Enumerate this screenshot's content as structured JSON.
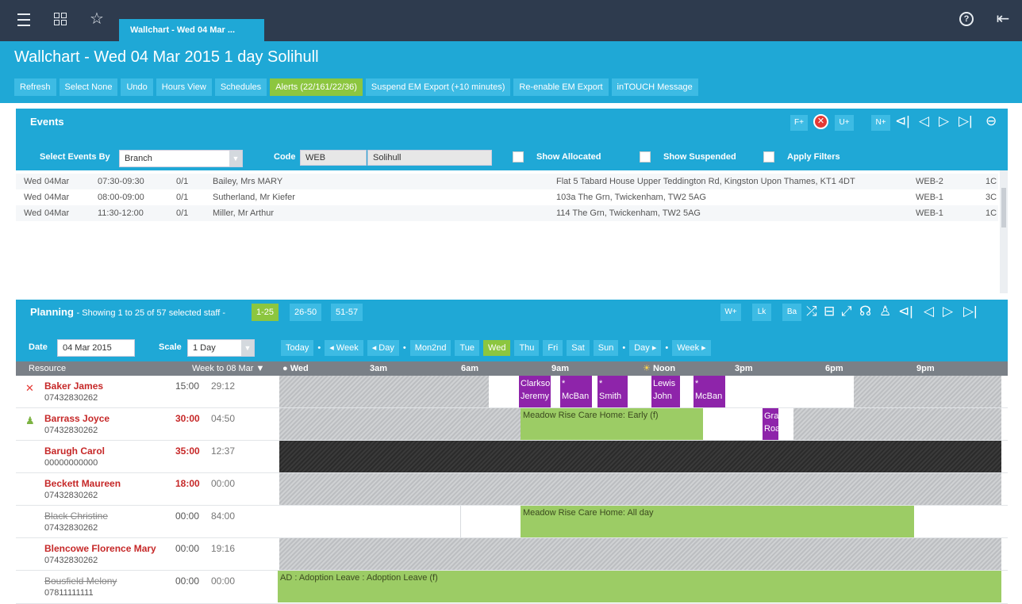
{
  "window": {
    "tab": "Wallchart - Wed 04 Mar ..."
  },
  "page": {
    "title": "Wallchart - Wed 04 Mar 2015 1 day Solihull",
    "actions": [
      "Refresh",
      "Select None",
      "Undo",
      "Hours View",
      "Schedules",
      "Alerts (22/161/22/36)",
      "Suspend EM Export (+10 minutes)",
      "Re-enable EM Export",
      "inTOUCH Message"
    ]
  },
  "events": {
    "title": "Events",
    "buttons": {
      "f": "F+",
      "u": "U+",
      "n": "N+"
    },
    "filters": {
      "select_by_label": "Select Events By",
      "select_by_value": "Branch",
      "code_label": "Code",
      "code_value": "WEB",
      "branch_value": "Solihull",
      "show_allocated": "Show Allocated",
      "show_suspended": "Show Suspended",
      "apply_filters": "Apply Filters"
    },
    "rows": [
      {
        "day": "Wed",
        "date": "04Mar",
        "time": "07:30-09:30",
        "alloc": "0/1",
        "client": "Bailey, Mrs MARY",
        "address": "Flat 5 Tabard House Upper Teddington Rd, Kingston Upon Thames, KT1 4DT",
        "code": "WEB-2",
        "extra": "1C"
      },
      {
        "day": "Wed",
        "date": "04Mar",
        "time": "08:00-09:00",
        "alloc": "0/1",
        "client": "Sutherland, Mr Kiefer",
        "address": "103a The Grn, Twickenham, TW2 5AG",
        "code": "WEB-1",
        "extra": "3C"
      },
      {
        "day": "Wed",
        "date": "04Mar",
        "time": "11:30-12:00",
        "alloc": "0/1",
        "client": "Miller, Mr Arthur",
        "address": "114 The Grn, Twickenham, TW2 5AG",
        "code": "WEB-1",
        "extra": "1C"
      }
    ]
  },
  "planning": {
    "title": "Planning",
    "subtitle": "- Showing 1 to 25 of 57 selected staff -",
    "pages": [
      "1-25",
      "26-50",
      "51-57"
    ],
    "buttons": {
      "w": "W+",
      "lk": "Lk",
      "ba": "Ba"
    },
    "date_label": "Date",
    "date_value": "04 Mar 2015",
    "scale_label": "Scale",
    "scale_value": "1 Day",
    "daynav": [
      "Today",
      "◂ Week",
      "◂ Day",
      "Mon2nd",
      "Tue",
      "Wed",
      "Thu",
      "Fri",
      "Sat",
      "Sun",
      "Day ▸",
      "Week ▸"
    ],
    "grid_header": {
      "resource": "Resource",
      "week": "Week to 08 Mar ▼",
      "times": [
        "Wed",
        "3am",
        "6am",
        "9am",
        "Noon",
        "3pm",
        "6pm",
        "9pm"
      ]
    },
    "staff": [
      {
        "name": "Baker James",
        "phone": "07432830262",
        "h1": "15:00",
        "h2": "29:12"
      },
      {
        "name": "Barrass Joyce",
        "phone": "07432830262",
        "h1": "30:00",
        "h2": "04:50"
      },
      {
        "name": "Barugh Carol",
        "phone": "00000000000",
        "h1": "35:00",
        "h2": "12:37"
      },
      {
        "name": "Beckett Maureen",
        "phone": "07432830262",
        "h1": "18:00",
        "h2": "00:00"
      },
      {
        "name": "Black Christine",
        "phone": "07432830262",
        "h1": "00:00",
        "h2": "84:00"
      },
      {
        "name": "Blencowe Florence Mary",
        "phone": "07432830262",
        "h1": "00:00",
        "h2": "19:16"
      },
      {
        "name": "Bousfield Melony",
        "phone": "07811111111",
        "h1": "00:00",
        "h2": "00:00"
      }
    ],
    "blocks": {
      "baker_1": [
        "Clarkso",
        "Jeremy"
      ],
      "baker_2": [
        "*",
        "McBan"
      ],
      "baker_3": [
        "*",
        "Smith"
      ],
      "baker_4": [
        "Lewis",
        "John"
      ],
      "baker_5": [
        "*",
        "McBan"
      ],
      "barrass_green": "Meadow Rise Care Home: Early (f)",
      "barrass_purple": [
        "Gra",
        "Roa"
      ],
      "black_green": "Meadow Rise Care Home: All day",
      "bousfield_green": "AD : Adoption Leave : Adoption Leave (f)"
    }
  }
}
